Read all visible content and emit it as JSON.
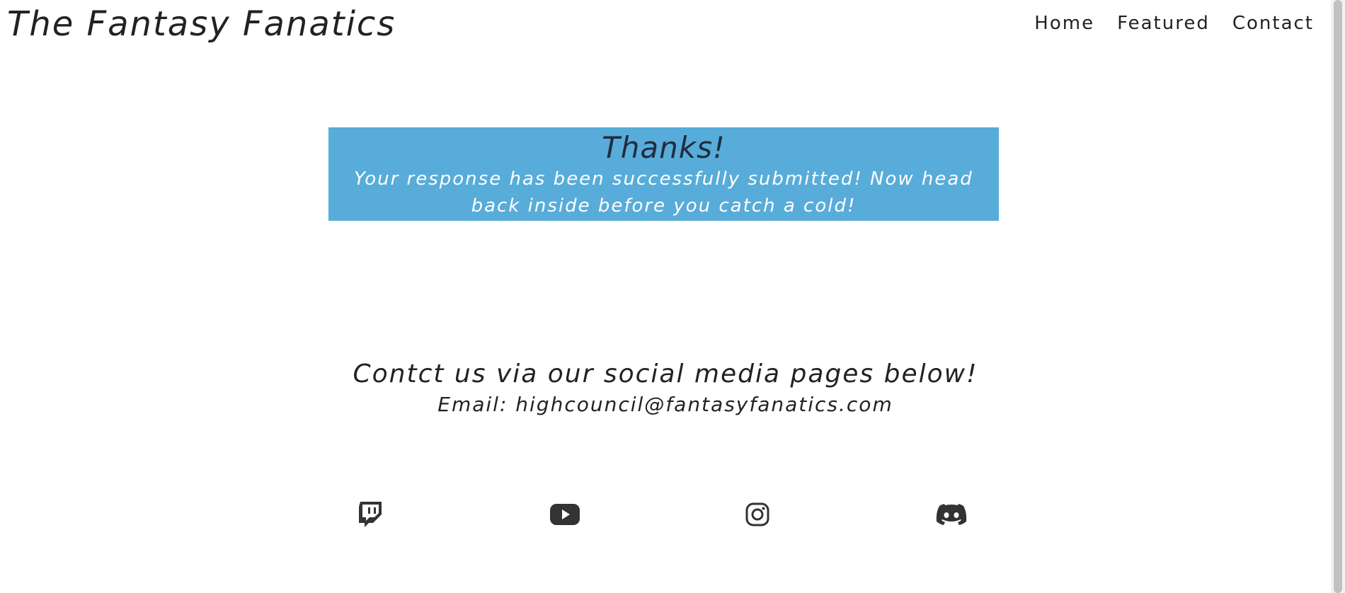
{
  "header": {
    "site_title": "The Fantasy Fanatics",
    "nav": [
      {
        "label": "Home"
      },
      {
        "label": "Featured"
      },
      {
        "label": "Contact"
      }
    ]
  },
  "confirmation": {
    "heading": "Thanks!",
    "message": "Your response has been successfully submitted! Now head back inside before you catch a cold!",
    "background_color": "#58acd9"
  },
  "contact": {
    "heading": "Contct us via our social media pages below!",
    "email_line": "Email: highcouncil@fantasyfanatics.com"
  },
  "socials": [
    {
      "icon": "twitch-icon"
    },
    {
      "icon": "youtube-icon"
    },
    {
      "icon": "instagram-icon"
    },
    {
      "icon": "discord-icon"
    }
  ],
  "colors": {
    "text": "#222222",
    "icon": "#333333",
    "accent": "#58acd9"
  }
}
